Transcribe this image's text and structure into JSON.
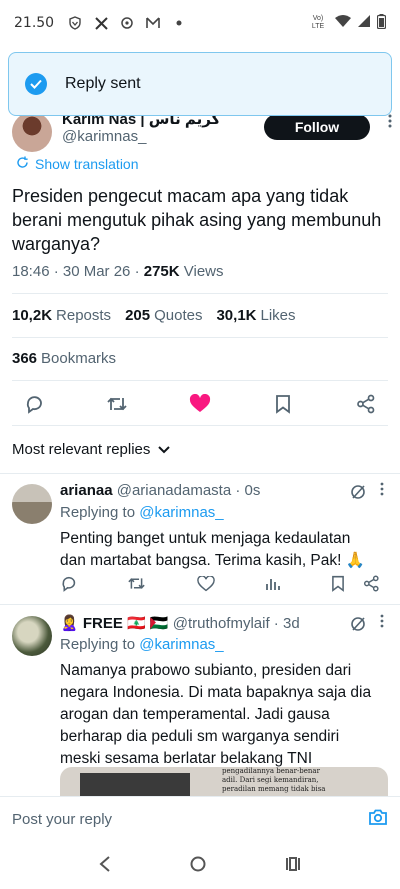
{
  "status_bar": {
    "time": "21.50",
    "network": "Vo) LTE"
  },
  "toast": {
    "message": "Reply sent"
  },
  "tweet": {
    "author_name": "Karim Nas | كريم ناس",
    "author_handle": "@karimnas_",
    "follow_label": "Follow",
    "show_translation": "Show translation",
    "text": "Presiden pengecut macam apa yang tidak berani mengutuk pihak asing yang membunuh warganya?",
    "timestamp": "18:46 · 30 Mar 26 · ",
    "views_count": "275K",
    "views_label": " Views",
    "reposts_count": "10,2K",
    "reposts_label": "Reposts",
    "quotes_count": "205",
    "quotes_label": "Quotes",
    "likes_count": "30,1K",
    "likes_label": "Likes",
    "bookmarks_count": "366",
    "bookmarks_label": "Bookmarks",
    "liked": true
  },
  "replies_header": {
    "label": "Most relevant replies"
  },
  "replies": [
    {
      "name": "arianaa",
      "handle": "@arianadamasta · 0s",
      "replying_prefix": "Replying to ",
      "replying_to": "@karimnas_",
      "text": "Penting banget untuk menjaga kedaulatan dan martabat bangsa. Terima kasih, Pak! 🙏"
    },
    {
      "name": "🙎‍♀️ FREE 🇱🇧 🇵🇸",
      "handle": "@truthofmylaif · 3d",
      "replying_prefix": "Replying to ",
      "replying_to": "@karimnas_",
      "text": "Namanya prabowo subianto, presiden dari negara Indonesia. Di mata bapaknya saja dia arogan dan temperamental. Jadi gausa berharap dia peduli sm warganya sendiri meski sesama berlatar belakang TNI",
      "media_text": [
        "pengadilannya benar-benar",
        "adil. Dari segi kemandiran,",
        "peradilan memang tidak bisa"
      ]
    }
  ],
  "compose": {
    "placeholder": "Post your reply"
  },
  "colors": {
    "accent": "#1d9bf0",
    "like": "#f91880",
    "text": "#0f1419",
    "muted": "#536471"
  }
}
